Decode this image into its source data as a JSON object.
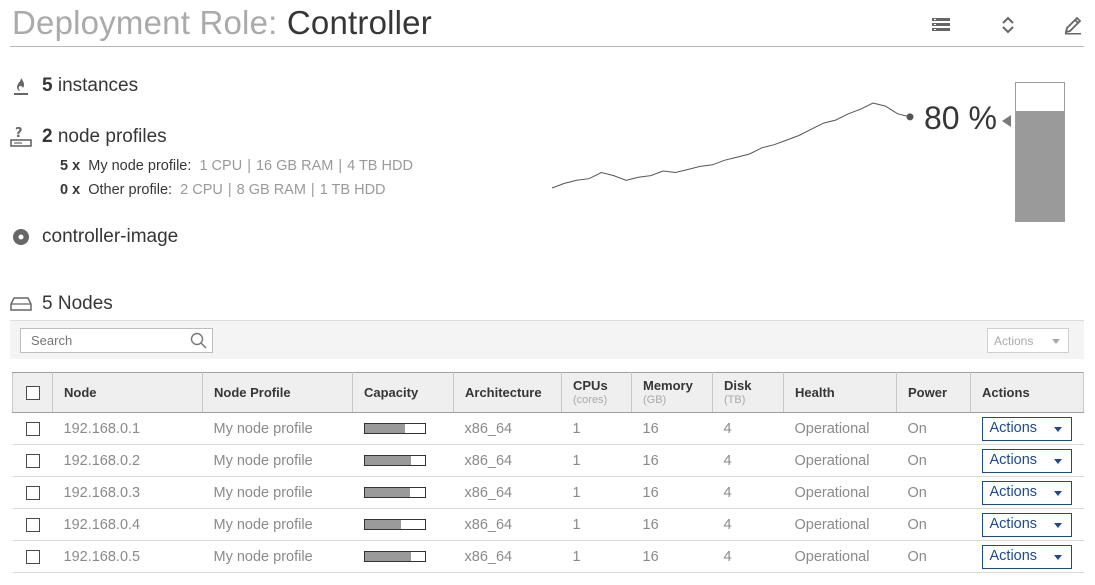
{
  "header": {
    "title_prefix": "Deployment Role: ",
    "title_role": "Controller",
    "icons": [
      "list-icon",
      "expand-collapse-icon",
      "edit-pencil-icon"
    ]
  },
  "summary": {
    "instances_count": "5",
    "instances_label": " instances",
    "profiles_count": "2",
    "profiles_label": " node profiles",
    "profiles": [
      {
        "count": "5 x",
        "name": "My node profile:",
        "cpu": "1 CPU",
        "ram": "16 GB RAM",
        "hdd": "4 TB HDD"
      },
      {
        "count": "0 x",
        "name": "Other profile:",
        "cpu": "2 CPU",
        "ram": "8 GB RAM",
        "hdd": "1 TB HDD"
      }
    ],
    "image_label": "controller-image",
    "separator": "|"
  },
  "usage": {
    "percent_text": "80 %",
    "percent": 0.8,
    "trend": [
      2,
      5,
      7,
      8,
      12,
      10,
      7,
      9,
      10,
      13,
      12,
      14,
      16,
      17,
      20,
      22,
      24,
      28,
      30,
      33,
      36,
      40,
      44,
      46,
      50,
      53,
      57,
      55,
      50,
      48
    ]
  },
  "nodes": {
    "title": "5 Nodes",
    "search_placeholder": "Search",
    "toolbar_actions_label": "Actions",
    "columns": {
      "node": "Node",
      "profile": "Node Profile",
      "capacity": "Capacity",
      "architecture": "Architecture",
      "cpus": "CPUs",
      "cpus_unit": "(cores)",
      "memory": "Memory",
      "memory_unit": "(GB)",
      "disk": "Disk",
      "disk_unit": "(TB)",
      "health": "Health",
      "power": "Power",
      "actions": "Actions"
    },
    "rows": [
      {
        "node": "192.168.0.1",
        "profile": "My node profile",
        "capacity": 0.68,
        "architecture": "x86_64",
        "cpus": "1",
        "memory": "16",
        "disk": "4",
        "health": "Operational",
        "power": "On",
        "action": "Actions"
      },
      {
        "node": "192.168.0.2",
        "profile": "My node profile",
        "capacity": 0.78,
        "architecture": "x86_64",
        "cpus": "1",
        "memory": "16",
        "disk": "4",
        "health": "Operational",
        "power": "On",
        "action": "Actions"
      },
      {
        "node": "192.168.0.3",
        "profile": "My node profile",
        "capacity": 0.75,
        "architecture": "x86_64",
        "cpus": "1",
        "memory": "16",
        "disk": "4",
        "health": "Operational",
        "power": "On",
        "action": "Actions"
      },
      {
        "node": "192.168.0.4",
        "profile": "My node profile",
        "capacity": 0.6,
        "architecture": "x86_64",
        "cpus": "1",
        "memory": "16",
        "disk": "4",
        "health": "Operational",
        "power": "On",
        "action": "Actions"
      },
      {
        "node": "192.168.0.5",
        "profile": "My node profile",
        "capacity": 0.77,
        "architecture": "x86_64",
        "cpus": "1",
        "memory": "16",
        "disk": "4",
        "health": "Operational",
        "power": "On",
        "action": "Actions"
      }
    ]
  }
}
